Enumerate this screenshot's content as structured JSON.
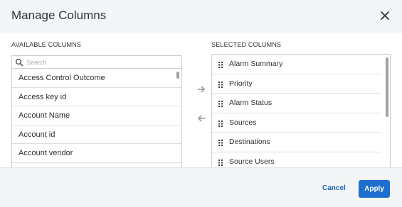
{
  "dialog": {
    "title": "Manage Columns"
  },
  "available": {
    "label": "AVAILABLE COLUMNS",
    "search_placeholder": "Search",
    "items": [
      "Access Control Outcome",
      "Access key id",
      "Account Name",
      "Account id",
      "Account vendor",
      ""
    ]
  },
  "selected": {
    "label": "SELECTED COLUMNS",
    "items": [
      "Alarm Summary",
      "Priority",
      "Alarm Status",
      "Sources",
      "Destinations",
      "Source Users"
    ]
  },
  "footer": {
    "cancel_label": "Cancel",
    "apply_label": "Apply"
  },
  "colors": {
    "accent": "#1f6fcf",
    "link": "#1b67c4",
    "header_bg": "#f4f5f6",
    "border": "#c9ced3"
  }
}
